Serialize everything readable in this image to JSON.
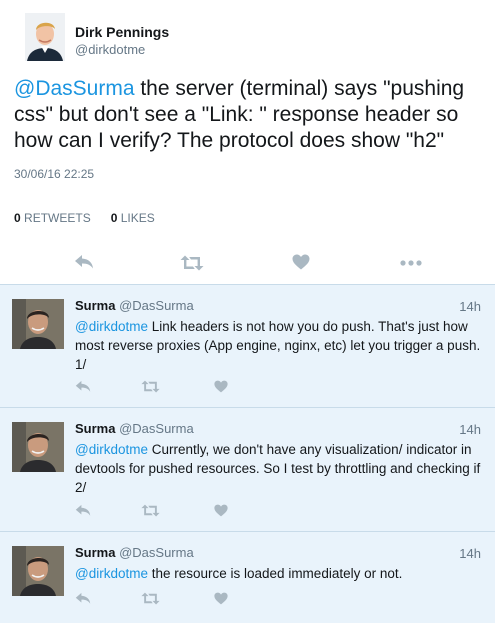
{
  "main": {
    "author_name": "Dirk Pennings",
    "author_handle": "@dirkdotme",
    "mention": "@DasSurma",
    "text": " the server (terminal) says \"pushing css\" but don't see a \"Link: \" response header so how can I verify? The protocol does show \"h2\"",
    "timestamp": "30/06/16 22:25",
    "retweets_count": "0",
    "retweets_label": "RETWEETS",
    "likes_count": "0",
    "likes_label": "LIKES"
  },
  "replies": [
    {
      "name": "Surma",
      "handle": "@DasSurma",
      "time": "14h",
      "mention": "@dirkdotme",
      "text": " Link headers is not how you do push. That's just how most reverse proxies (App engine, nginx, etc) let you trigger a push. 1/"
    },
    {
      "name": "Surma",
      "handle": "@DasSurma",
      "time": "14h",
      "mention": "@dirkdotme",
      "text": " Currently, we don't have any visualization/ indicator in devtools for pushed resources. So I test by throttling and checking if 2/"
    },
    {
      "name": "Surma",
      "handle": "@DasSurma",
      "time": "14h",
      "mention": "@dirkdotme",
      "text": " the resource is loaded immediately or not."
    }
  ],
  "colors": {
    "link": "#1b95e0",
    "icon": "#aab8c2",
    "reply_bg": "#e9f3fb"
  },
  "icons": [
    "reply-icon",
    "retweet-icon",
    "like-icon",
    "more-icon"
  ]
}
